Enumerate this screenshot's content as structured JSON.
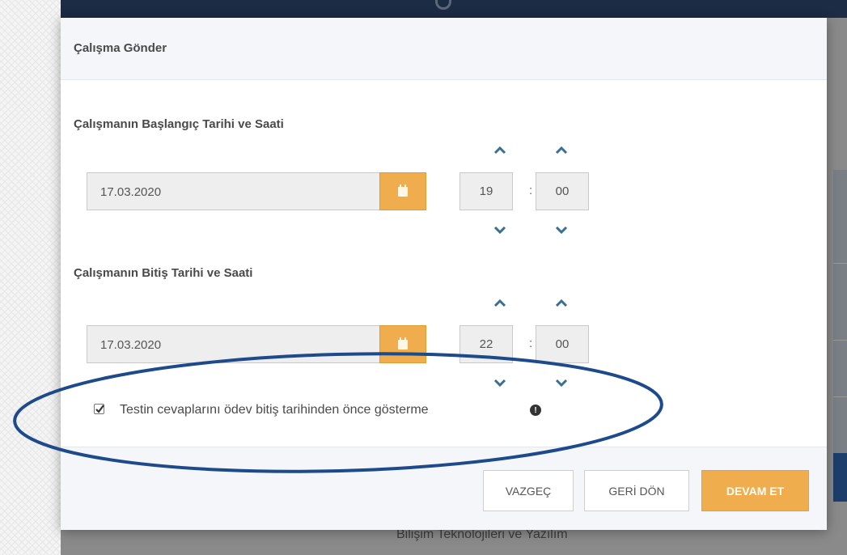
{
  "modal": {
    "title": "Çalışma Gönder",
    "start": {
      "label": "Çalışmanın Başlangıç Tarihi ve Saati",
      "date": "17.03.2020",
      "hour": "19",
      "minute": "00"
    },
    "end": {
      "label": "Çalışmanın Bitiş Tarihi ve Saati",
      "date": "17.03.2020",
      "hour": "22",
      "minute": "00"
    },
    "checkbox": {
      "label": "Testin cevaplarını ödev bitiş tarihinden önce gösterme",
      "checked": true
    },
    "buttons": {
      "cancel": "VAZGEÇ",
      "back": "GERİ DÖN",
      "continue": "DEVAM ET"
    },
    "time_separator": ":"
  },
  "background": {
    "bottom_text": "Bilişim Teknolojileri ve Yazılım"
  },
  "colors": {
    "accent": "#f0ad4e",
    "header_bg": "#f4f6f9",
    "chevron": "#3a6f95",
    "annotation": "#1d4a8a"
  },
  "icons": {
    "calendar": "calendar-icon",
    "chevron_up": "chevron-up-icon",
    "chevron_down": "chevron-down-icon",
    "info": "info-icon",
    "search": "search-icon"
  }
}
